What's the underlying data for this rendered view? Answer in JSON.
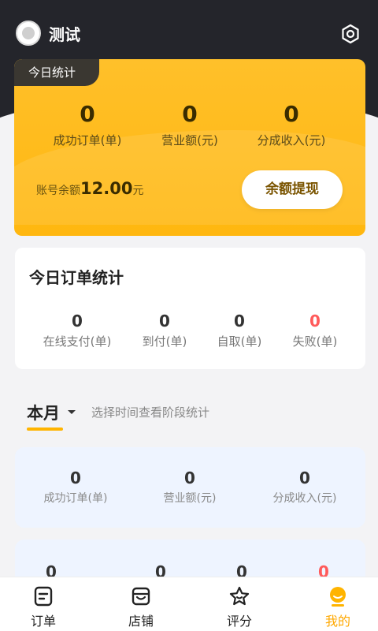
{
  "header": {
    "username": "测试"
  },
  "today": {
    "tag": "今日统计",
    "stats": [
      {
        "value": "0",
        "label": "成功订单(单)"
      },
      {
        "value": "0",
        "label": "营业额(元)"
      },
      {
        "value": "0",
        "label": "分成收入(元)"
      }
    ],
    "balance_label": "账号余额",
    "balance_amount": "12.00",
    "balance_unit": "元",
    "withdraw_label": "余额提现"
  },
  "orders": {
    "title": "今日订单统计",
    "stats": [
      {
        "value": "0",
        "label": "在线支付(单)"
      },
      {
        "value": "0",
        "label": "到付(单)"
      },
      {
        "value": "0",
        "label": "自取(单)"
      },
      {
        "value": "0",
        "label": "失败(单)"
      }
    ]
  },
  "period": {
    "selected": "本月",
    "hint": "选择时间查看阶段统计"
  },
  "period_stats": [
    {
      "value": "0",
      "label": "成功订单(单)"
    },
    {
      "value": "0",
      "label": "营业额(元)"
    },
    {
      "value": "0",
      "label": "分成收入(元)"
    }
  ],
  "period_stats2": [
    {
      "value": "0"
    },
    {
      "value": "0"
    },
    {
      "value": "0"
    },
    {
      "value": "0"
    }
  ],
  "tabs": [
    {
      "label": "订单",
      "icon": "order-icon"
    },
    {
      "label": "店铺",
      "icon": "store-icon"
    },
    {
      "label": "评分",
      "icon": "star-icon"
    },
    {
      "label": "我的",
      "icon": "profile-icon"
    }
  ],
  "colors": {
    "accent": "#ffb400",
    "active_tab": "#ffa800",
    "fail": "#ff5a5a",
    "dark_header": "#24252b"
  }
}
